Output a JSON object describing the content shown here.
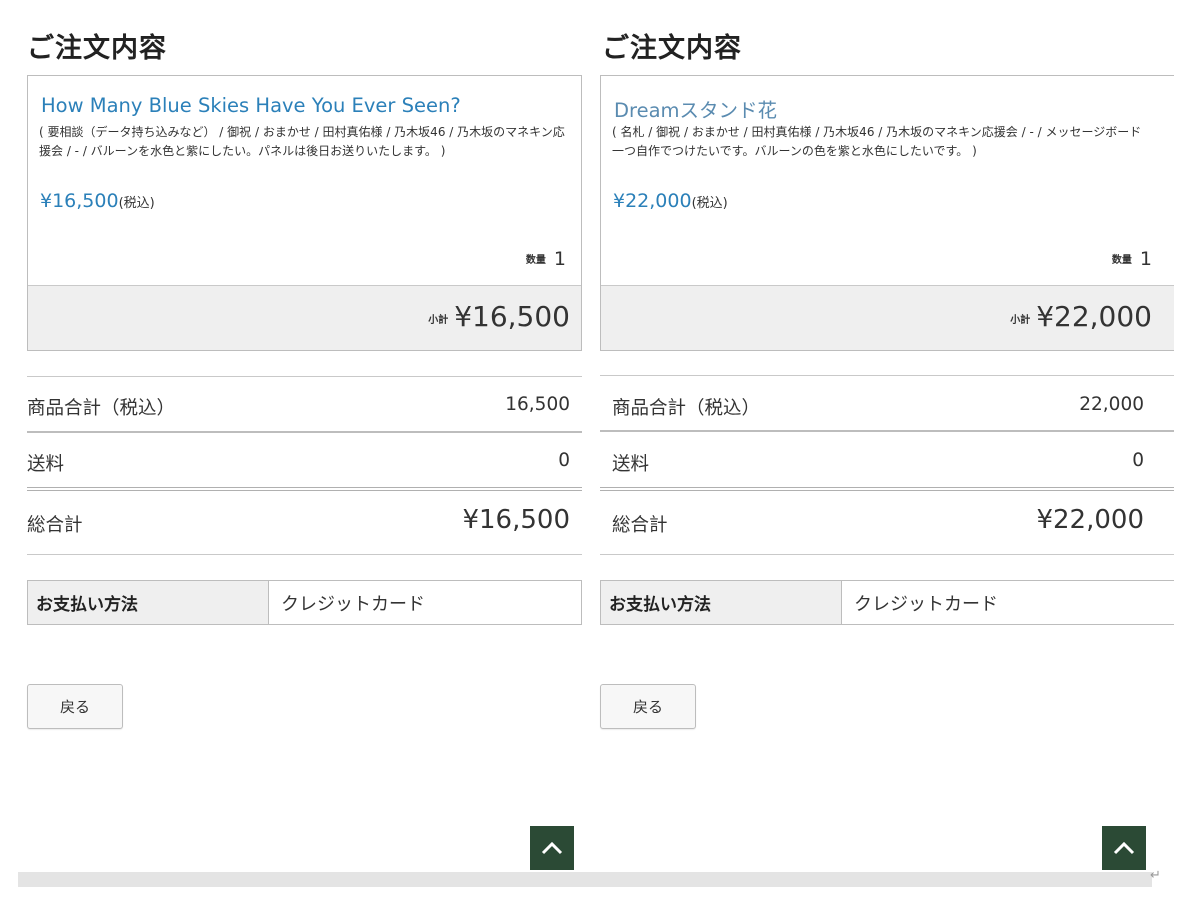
{
  "colors": {
    "link_blue": "#2b80b9",
    "top_button_green": "#2b4a35",
    "subtotal_bg": "#efefef",
    "border": "#bdbdbd"
  },
  "panels": [
    {
      "title": "ご注文内容",
      "item": {
        "name": "How Many Blue Skies Have You Ever Seen?",
        "options": "( 要相談（データ持ち込みなど） / 御祝 / おまかせ / 田村真佑様 / 乃木坂46 / 乃木坂のマネキン応援会 / - / バルーンを水色と紫にしたい。パネルは後日お送りいたします。 )",
        "price": "¥16,500",
        "tax_label": "(税込)",
        "qty_label": "数量",
        "qty": "1",
        "subtotal_label": "小計",
        "subtotal": "¥16,500"
      },
      "summary": {
        "items_total_label": "商品合計（税込）",
        "items_total": "16,500",
        "shipping_label": "送料",
        "shipping": "0",
        "grand_total_label": "総合計",
        "grand_total": "¥16,500"
      },
      "payment": {
        "label": "お支払い方法",
        "value": "クレジットカード"
      },
      "back_label": "戻る",
      "top_icon": "chevron-up-icon"
    },
    {
      "title": "ご注文内容",
      "item": {
        "name": "Dreamスタンド花",
        "options": "( 名札 / 御祝 / おまかせ / 田村真佑様 / 乃木坂46 / 乃木坂のマネキン応援会 / - / メッセージボード一つ自作でつけたいです。バルーンの色を紫と水色にしたいです。 )",
        "price": "¥22,000",
        "tax_label": "(税込)",
        "qty_label": "数量",
        "qty": "1",
        "subtotal_label": "小計",
        "subtotal": "¥22,000"
      },
      "summary": {
        "items_total_label": "商品合計（税込）",
        "items_total": "22,000",
        "shipping_label": "送料",
        "shipping": "0",
        "grand_total_label": "総合計",
        "grand_total": "¥22,000"
      },
      "payment": {
        "label": "お支払い方法",
        "value": "クレジットカード"
      },
      "back_label": "戻る",
      "top_icon": "chevron-up-icon"
    }
  ]
}
